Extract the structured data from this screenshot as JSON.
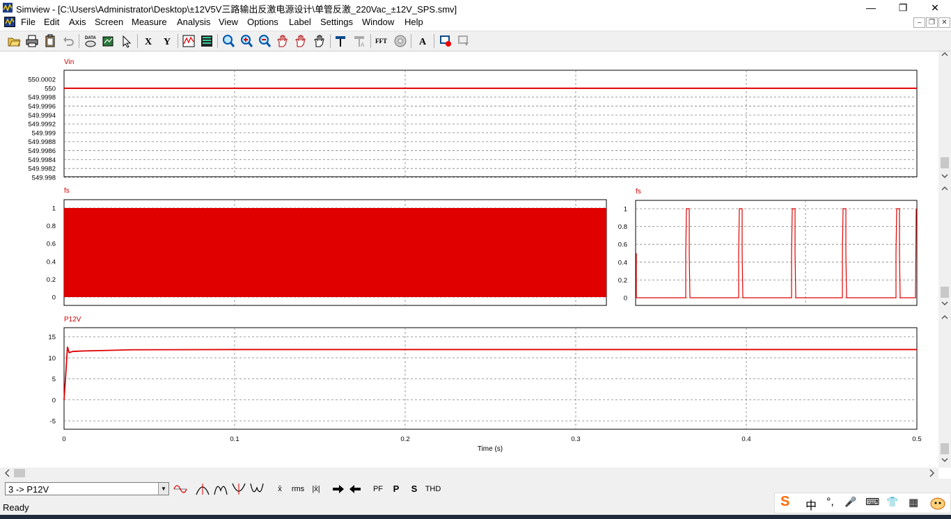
{
  "window": {
    "title": "Simview - [C:\\Users\\Administrator\\Desktop\\±12V5V三路输出反激电源设计\\单管反激_220Vac_±12V_SPS.smv]",
    "minimize": "—",
    "restore": "❐",
    "close": "✕"
  },
  "menu": {
    "items": [
      "File",
      "Edit",
      "Axis",
      "Screen",
      "Measure",
      "Analysis",
      "View",
      "Options",
      "Label",
      "Settings",
      "Window",
      "Help"
    ],
    "mdi_min": "–",
    "mdi_restore": "❐",
    "mdi_close": "✕"
  },
  "toolbar": {
    "x_label": "X",
    "y_label": "Y",
    "fft_label": "FFT",
    "text_label": "A",
    "data_label": "DATA"
  },
  "colors": {
    "trace": "#e00000",
    "grid": "#7f7f7f",
    "axis_text": "#000000",
    "title_text": "#cc0000"
  },
  "charts_text": {
    "vin_title": "Vin",
    "fs_title": "fs",
    "fs_zoom_title": "fs",
    "p12v_title": "P12V",
    "xlabel": "Time (s)"
  },
  "chart_data": [
    {
      "type": "line",
      "title": "Vin",
      "yticks": [
        "550.0002",
        "550",
        "549.9998",
        "549.9996",
        "549.9994",
        "549.9992",
        "549.999",
        "549.9988",
        "549.9986",
        "549.9984",
        "549.9982",
        "549.998"
      ],
      "ylim": [
        549.998,
        550.0002
      ],
      "xlim": [
        0,
        0.5
      ],
      "grid": true,
      "series": [
        {
          "name": "Vin",
          "x": [
            0,
            0.5
          ],
          "y": [
            550,
            550
          ]
        }
      ]
    },
    {
      "type": "area",
      "title": "fs",
      "yticks": [
        "1",
        "0.8",
        "0.6",
        "0.4",
        "0.2",
        "0"
      ],
      "ylim": [
        0,
        1
      ],
      "xlim": [
        0,
        0.5
      ],
      "grid": true,
      "filled_range": [
        0,
        1
      ],
      "series": [
        {
          "name": "fs",
          "description_value": "switching between 0 and 1"
        }
      ]
    },
    {
      "type": "line",
      "title": "fs",
      "yticks": [
        "1",
        "0.8",
        "0.6",
        "0.4",
        "0.2",
        "0"
      ],
      "ylim": [
        0,
        1
      ],
      "grid": true,
      "series": [
        {
          "name": "fs",
          "pulses": 5,
          "high": 1,
          "low": 0
        }
      ]
    },
    {
      "type": "line",
      "title": "P12V",
      "xlabel": "Time (s)",
      "yticks": [
        "15",
        "10",
        "5",
        "0",
        "-5"
      ],
      "ylim": [
        -7,
        17
      ],
      "xticks": [
        "0",
        "0.1",
        "0.2",
        "0.3",
        "0.4",
        "0.5"
      ],
      "xlim": [
        0,
        0.5
      ],
      "grid": true,
      "series": [
        {
          "name": "P12V",
          "x": [
            0,
            0.001,
            0.002,
            0.003,
            0.005,
            0.01,
            0.02,
            0.04,
            0.1,
            0.3,
            0.5
          ],
          "y": [
            0,
            6,
            12.6,
            11.2,
            11.5,
            11.6,
            11.7,
            11.9,
            11.95,
            11.95,
            11.95
          ]
        }
      ]
    }
  ],
  "bottom": {
    "trace_select": "3 -> P12V",
    "buttons": [
      "x̄",
      "rms",
      "|x̄|",
      "PF",
      "P",
      "S",
      "THD"
    ]
  },
  "status": {
    "text": "Ready"
  },
  "ime": {
    "items": [
      "S",
      "中",
      "°,",
      "🎤",
      "⌨",
      "👕",
      "▦"
    ]
  }
}
